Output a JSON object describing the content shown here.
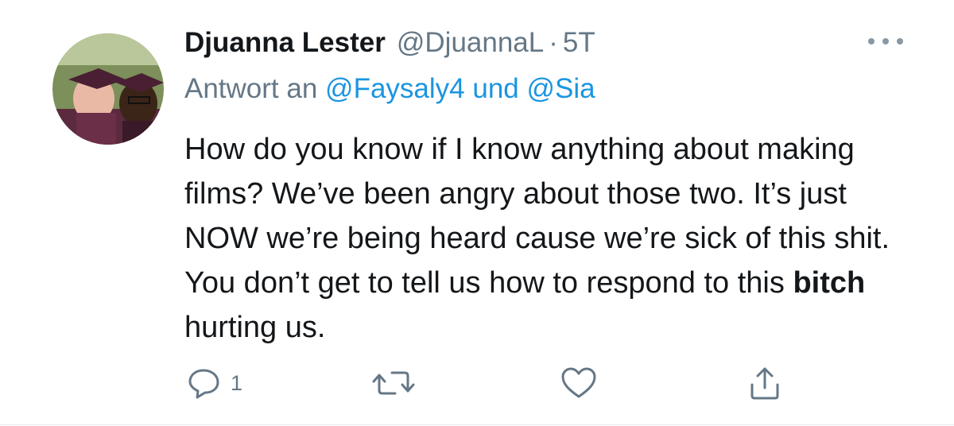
{
  "tweet": {
    "display_name": "Djuanna Lester",
    "handle": "@DjuannaL",
    "separator": "·",
    "time": "5T",
    "reply_prefix": "Antwort an",
    "reply_user_1": "@Faysaly4",
    "reply_joiner": "und",
    "reply_user_2": "@Sia",
    "text_part_1": "How do you know if I know anything about making films? We’ve been angry about those two. It’s just NOW we’re being heard cause we’re sick of this shit. You don’t get to tell us how to respond to this ",
    "text_bold": "bitch",
    "text_part_2": " hurting us."
  },
  "actions": {
    "reply_icon": "reply-bubble-icon",
    "reply_count": "1",
    "retweet_icon": "retweet-icon",
    "like_icon": "heart-icon",
    "share_icon": "share-icon"
  },
  "colors": {
    "primary_text": "#14171a",
    "secondary_text": "#657786",
    "link": "#1b95e0",
    "icon": "#657786"
  }
}
